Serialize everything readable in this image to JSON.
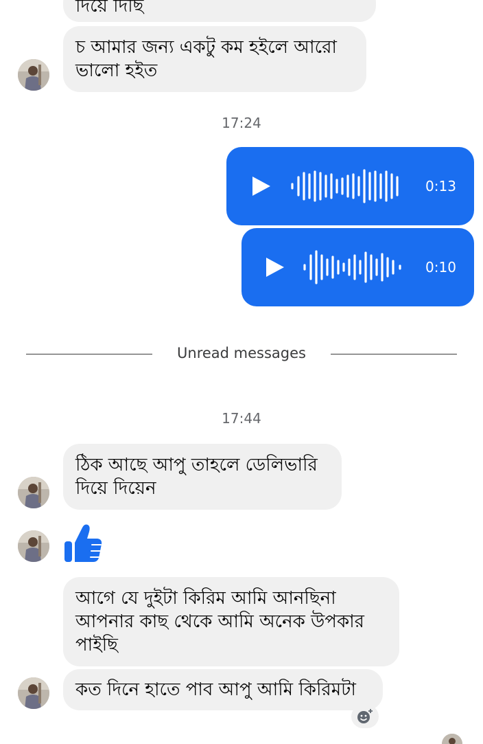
{
  "chat": {
    "messages": [
      {
        "id": "m0",
        "sender": "contact",
        "text": "দিয়ে দিছি"
      },
      {
        "id": "m1",
        "sender": "contact",
        "text": "চ আমার জন্য একটু কম হইলে আরো ভালো হইত"
      },
      {
        "id": "m2",
        "sender": "contact",
        "text": "ঠিক আছে আপু তাহলে ডেলিভারি দিয়ে দিয়েন"
      },
      {
        "id": "m3",
        "sender": "contact",
        "type": "like",
        "icon": "thumbs-up-icon"
      },
      {
        "id": "m4",
        "sender": "contact",
        "text": "আগে যে দুইটা কিরিম আমি আনছিনা আপনার কাছ থেকে আমি অনেক উপকার পাইছি"
      },
      {
        "id": "m5",
        "sender": "contact",
        "text": "কত দিনে হাতে পাব আপু আমি কিরিমটা"
      }
    ],
    "timestamps": [
      "17:24",
      "17:44"
    ],
    "voice_messages": [
      {
        "id": "v1",
        "sender": "me",
        "duration": "0:13",
        "icon": "play-icon"
      },
      {
        "id": "v2",
        "sender": "me",
        "duration": "0:10",
        "icon": "play-icon"
      }
    ],
    "unread_divider": "Unread messages",
    "add_reaction_icon": "add-reaction-icon"
  },
  "colors": {
    "accent": "#1a6ef0",
    "incoming_bubble": "#f0f0f0",
    "timestamp": "#65676b",
    "like": "#1a6ef0"
  }
}
